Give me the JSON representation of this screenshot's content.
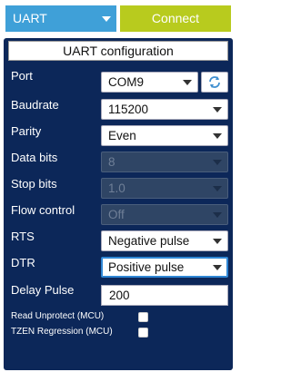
{
  "header": {
    "interface": "UART",
    "connect_label": "Connect"
  },
  "panel": {
    "title": "UART configuration",
    "fields": {
      "port": {
        "label": "Port",
        "value": "COM9"
      },
      "baudrate": {
        "label": "Baudrate",
        "value": "115200"
      },
      "parity": {
        "label": "Parity",
        "value": "Even"
      },
      "data_bits": {
        "label": "Data bits",
        "value": "8"
      },
      "stop_bits": {
        "label": "Stop bits",
        "value": "1.0"
      },
      "flow_control": {
        "label": "Flow control",
        "value": "Off"
      },
      "rts": {
        "label": "RTS",
        "value": "Negative pulse"
      },
      "dtr": {
        "label": "DTR",
        "value": "Positive pulse"
      },
      "delay_pulse": {
        "label": "Delay Pulse",
        "value": "200"
      }
    },
    "checkboxes": {
      "read_unprotect": {
        "label": "Read Unprotect (MCU)",
        "checked": false
      },
      "tzen_regression": {
        "label": "TZEN Regression (MCU)",
        "checked": false
      }
    }
  },
  "icons": {
    "refresh": "refresh-icon",
    "chevron": "chevron-down-icon"
  },
  "colors": {
    "panel_bg": "#0c2759",
    "interface_bg": "#3fa0d8",
    "connect_bg": "#b8cb1e",
    "refresh_icon": "#3f8fd0"
  }
}
